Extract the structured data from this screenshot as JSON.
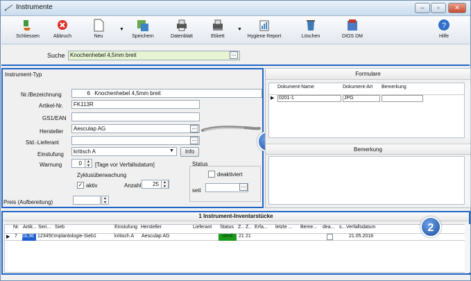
{
  "window": {
    "title": "Instrumente",
    "controls": [
      "–",
      "▫",
      "✕"
    ]
  },
  "toolbar": {
    "items": [
      {
        "label": "Schliessen",
        "icon": "close-app-icon"
      },
      {
        "label": "Abbruch",
        "icon": "cancel-icon"
      },
      {
        "label": "Neu",
        "icon": "new-document-icon"
      },
      {
        "label": "Speichern",
        "icon": "save-icon"
      },
      {
        "label": "Datenblatt",
        "icon": "print-icon"
      },
      {
        "label": "Etikett",
        "icon": "label-print-icon"
      },
      {
        "label": "Hygiene Report",
        "icon": "report-icon"
      },
      {
        "label": "Löschen",
        "icon": "delete-icon"
      },
      {
        "label": "DIOS DM",
        "icon": "dios-icon"
      },
      {
        "label": "Hilfe",
        "icon": "help-icon"
      }
    ]
  },
  "search": {
    "label": "Suche",
    "value": "Knochenhebel 4,5mm breit"
  },
  "instrument": {
    "section_title": "Instrument-Typ",
    "nr_label": "Nr./Bezeichnung",
    "nr_value": "6",
    "bezeichnung": "Knochenhebel 4,5mm breit",
    "artikel_label": "Artikel-Nr.",
    "artikel_value": "FK113R",
    "gs1_label": "GS1/EAN",
    "gs1_value": "",
    "hersteller_label": "Hersteller",
    "hersteller_value": "Aesculap AG",
    "lieferant_label": "Std.-Lieferant",
    "lieferant_value": "",
    "einstufung_label": "Einstufung",
    "einstufung_value": "kritisch A",
    "info_button": "Info",
    "warnung_label": "Warnung",
    "warnung_value": "0",
    "warnung_suffix": "[Tage vor Verfallsdatum]",
    "zyklus_label": "Zyklusüberwachung",
    "aktiv_label": "aktiv",
    "anzahl_label": "Anzahl",
    "anzahl_value": "25",
    "status_label": "Status",
    "deaktiviert_label": "deaktiviert",
    "seit_label": "seit",
    "preis_label": "Preis (Aufbereitung)",
    "preis_value": ""
  },
  "formulare": {
    "title": "Formulare",
    "columns": [
      "Dokument-Name",
      "Dokument-Art",
      "Bemerkung"
    ],
    "rows": [
      {
        "name": "0201-1",
        "art": "JPG",
        "bemerkung": ""
      }
    ],
    "bemerkung_title": "Bemerkung"
  },
  "inventory": {
    "title": "1 Instrument-Inventarstücke",
    "columns": [
      "Nr.",
      "Artik...",
      "Seri...",
      "Sieb",
      "Einstufung",
      "Hersteller",
      "Lieferant",
      "Status",
      "Z..",
      "Z..",
      "Erfa...",
      "letzte ...",
      "Beme...",
      "dea...",
      "s...",
      "Verfallsdatum"
    ],
    "rows": [
      {
        "nr": "7",
        "artikel": "DL36",
        "serie": "123456",
        "sieb": "Implantologie-Sieb1",
        "einstufung": "kritisch A",
        "hersteller": "Aesculap AG",
        "lieferant": "",
        "status": "steril",
        "z1": "21",
        "z2": "21",
        "verfall": "21.05.2018"
      }
    ]
  },
  "badges": [
    "1",
    "2"
  ],
  "colors": {
    "accent": "#1e64c8",
    "status_steril": "#1a9a1a",
    "selection": "#1f5fd0"
  }
}
